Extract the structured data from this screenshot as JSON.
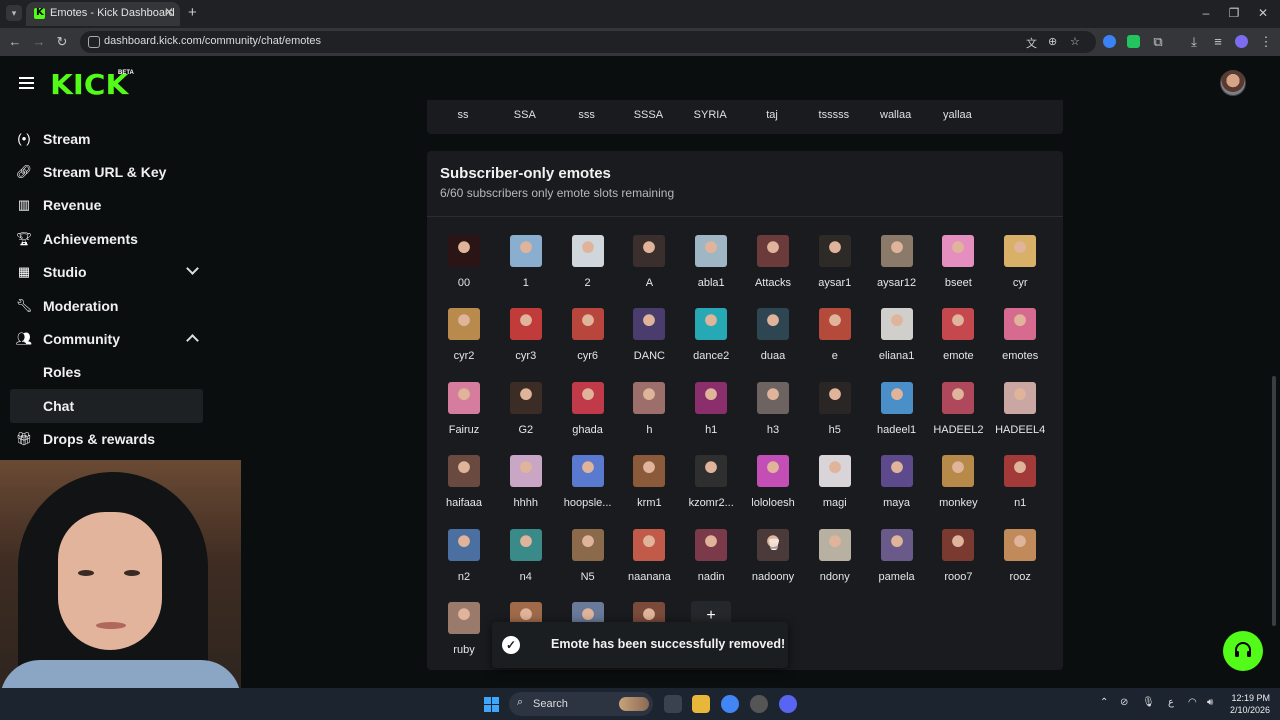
{
  "browser": {
    "tab_title": "Emotes - Kick Dashboard",
    "url": "dashboard.kick.com/community/chat/emotes"
  },
  "header": {
    "logo": "KICK",
    "beta": "BETA"
  },
  "sidebar": {
    "items": [
      {
        "label": "Stream",
        "icon": "stream-icon"
      },
      {
        "label": "Stream URL & Key",
        "icon": "link-icon"
      },
      {
        "label": "Revenue",
        "icon": "chart-icon"
      },
      {
        "label": "Achievements",
        "icon": "trophy-icon"
      },
      {
        "label": "Studio",
        "icon": "film-icon"
      },
      {
        "label": "Moderation",
        "icon": "wrench-icon"
      },
      {
        "label": "Community",
        "icon": "people-icon"
      },
      {
        "label": "Drops & rewards",
        "icon": "gift-icon"
      }
    ],
    "sub_items": [
      {
        "label": "Roles"
      },
      {
        "label": "Chat"
      }
    ]
  },
  "previous_section": {
    "emotes": [
      "ss",
      "SSA",
      "sss",
      "SSSA",
      "SYRIA",
      "taj",
      "tsssss",
      "wallaa",
      "yallaa"
    ]
  },
  "subscriber_section": {
    "title": "Subscriber-only emotes",
    "subtitle": "6/60 subscribers only emote slots remaining",
    "emotes": [
      {
        "name": "00",
        "color": "#2a1416"
      },
      {
        "name": "1",
        "color": "#8aaed0"
      },
      {
        "name": "2",
        "color": "#cfd6dc"
      },
      {
        "name": "A",
        "color": "#3a2f2c"
      },
      {
        "name": "abla1",
        "color": "#9fb7c4"
      },
      {
        "name": "Attacks",
        "color": "#6b3a3a"
      },
      {
        "name": "aysar1",
        "color": "#2e2a28"
      },
      {
        "name": "aysar12",
        "color": "#8b7a6a"
      },
      {
        "name": "bseet",
        "color": "#e58fc0"
      },
      {
        "name": "cyr",
        "color": "#d8b067"
      },
      {
        "name": "cyr2",
        "color": "#b88a4c"
      },
      {
        "name": "cyr3",
        "color": "#c23b3b"
      },
      {
        "name": "cyr6",
        "color": "#b8463c"
      },
      {
        "name": "DANC",
        "color": "#4a3c6c"
      },
      {
        "name": "dance2",
        "color": "#27a9b5"
      },
      {
        "name": "duaa",
        "color": "#2e4552"
      },
      {
        "name": "e",
        "color": "#b34a3a"
      },
      {
        "name": "eliana1",
        "color": "#d0cfcb"
      },
      {
        "name": "emote",
        "color": "#c5484f"
      },
      {
        "name": "emotes",
        "color": "#d76b8f"
      },
      {
        "name": "Fairuz",
        "color": "#d67c9c"
      },
      {
        "name": "G2",
        "color": "#3b2c26"
      },
      {
        "name": "ghada",
        "color": "#c03a4a"
      },
      {
        "name": "h",
        "color": "#9c6f6a"
      },
      {
        "name": "h1",
        "color": "#8a2f6b"
      },
      {
        "name": "h3",
        "color": "#6d6360"
      },
      {
        "name": "h5",
        "color": "#2a2626"
      },
      {
        "name": "hadeel1",
        "color": "#4a8fc7"
      },
      {
        "name": "HADEEL2",
        "color": "#b0485c"
      },
      {
        "name": "HADEEL4",
        "color": "#caa7a3"
      },
      {
        "name": "haifaaa",
        "color": "#6a4a40"
      },
      {
        "name": "hhhh",
        "color": "#c9a6c3"
      },
      {
        "name": "hoopsle...",
        "color": "#5a7ad0"
      },
      {
        "name": "krm1",
        "color": "#8a5a3a"
      },
      {
        "name": "kzomr2...",
        "color": "#2f2f2f"
      },
      {
        "name": "lololoesh",
        "color": "#c34fb6"
      },
      {
        "name": "magi",
        "color": "#d8d4d8"
      },
      {
        "name": "maya",
        "color": "#5d4a8c"
      },
      {
        "name": "monkey",
        "color": "#b88a4a"
      },
      {
        "name": "n1",
        "color": "#a23a3a"
      },
      {
        "name": "n2",
        "color": "#4a6fa0"
      },
      {
        "name": "n4",
        "color": "#3a8a8a"
      },
      {
        "name": "N5",
        "color": "#8a6a4a"
      },
      {
        "name": "naanana",
        "color": "#c25a4a"
      },
      {
        "name": "nadin",
        "color": "#7a3a4a"
      },
      {
        "name": "nadoony",
        "color": "#4a3a3a"
      },
      {
        "name": "ndony",
        "color": "#b8b0a0"
      },
      {
        "name": "pamela",
        "color": "#6a5a8a"
      },
      {
        "name": "rooo7",
        "color": "#7a3a30"
      },
      {
        "name": "rooz",
        "color": "#c08a5a"
      },
      {
        "name": "ruby",
        "color": "#9a7a6a"
      },
      {
        "name": "",
        "color": "#a06a4a"
      },
      {
        "name": "",
        "color": "#6a7a9a"
      },
      {
        "name": "",
        "color": "#7a4a3a"
      }
    ],
    "add_label": "+"
  },
  "toast": {
    "message": "Emote has been successfully removed!"
  },
  "taskbar": {
    "search": "Search",
    "time": "12:19 PM",
    "date": "2/10/2026"
  },
  "colors": {
    "brand": "#53fc18",
    "background": "#0b0e0f",
    "card": "#191b1f"
  }
}
